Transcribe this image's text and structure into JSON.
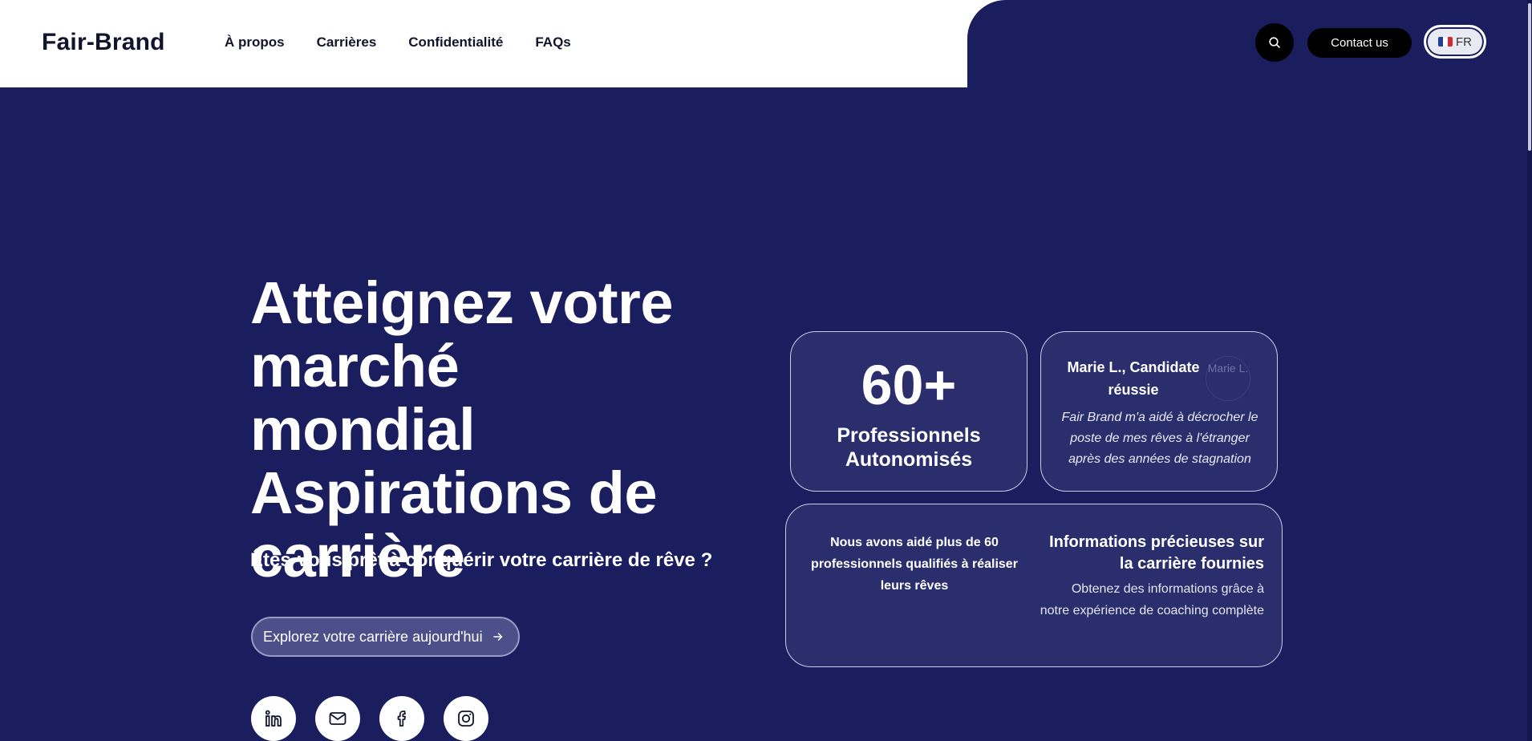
{
  "header": {
    "logo": "Fair-Brand",
    "nav": [
      "À propos",
      "Carrières",
      "Confidentialité",
      "FAQs"
    ],
    "search_icon": "search-icon",
    "contact_label": "Contact us",
    "lang_label": "FR",
    "lang_flag": "flag-fr-icon"
  },
  "hero": {
    "headline": "Atteignez votre marché mondial Aspirations de carrière",
    "subheadline": "Êtes-vous prêt à conquérir votre carrière de rêve ?",
    "cta_label": "Explorez votre carrière aujourd'hui",
    "cta_icon": "arrow-right-icon",
    "socials": [
      "linkedin-icon",
      "mail-icon",
      "facebook-icon",
      "instagram-icon"
    ]
  },
  "cards": {
    "stat": {
      "value": "60+",
      "label": "Professionnels Autonomisés"
    },
    "testimonial": {
      "name": "Marie L., Candidate réussie",
      "avatar_alt": "Marie L.",
      "quote": "Fair Brand m'a aidé à décrocher le poste de mes rêves à l'étranger après des années de stagnation"
    },
    "wide": {
      "left_text": "Nous avons aidé plus de 60 professionnels qualifiés à réaliser leurs rêves",
      "right_title": "Informations précieuses sur la carrière fournies",
      "right_body": "Obtenez des informations grâce à notre expérience de coaching complète"
    }
  },
  "colors": {
    "navy": "#1a1d5e",
    "card": "#2b2e6d",
    "white": "#ffffff",
    "black": "#000000"
  }
}
